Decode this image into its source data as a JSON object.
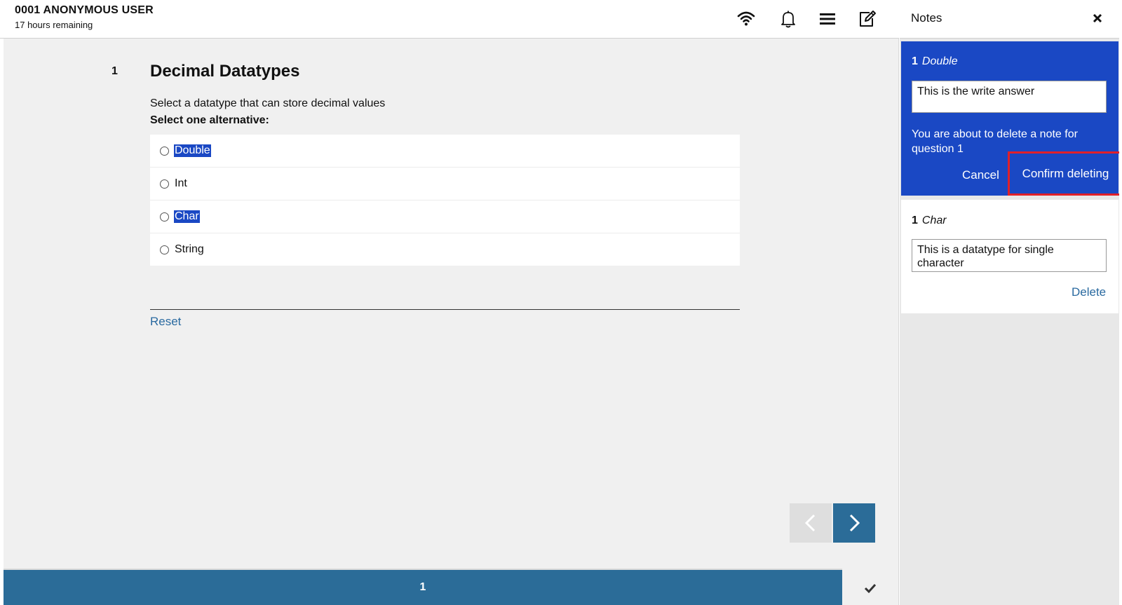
{
  "header": {
    "user_name": "0001 ANONYMOUS USER",
    "time_remaining": "17 hours remaining",
    "icons": [
      "wifi-icon",
      "bell-icon",
      "menu-icon",
      "edit-note-icon"
    ]
  },
  "question": {
    "number": "1",
    "title": "Decimal Datatypes",
    "text": "Select a datatype that can store decimal values",
    "instruction": "Select one alternative:",
    "options": [
      {
        "label": "Double",
        "highlighted": true,
        "selected": false
      },
      {
        "label": "Int",
        "highlighted": false,
        "selected": false
      },
      {
        "label": "Char",
        "highlighted": true,
        "selected": false
      },
      {
        "label": "String",
        "highlighted": false,
        "selected": false
      }
    ],
    "reset_label": "Reset"
  },
  "footer": {
    "page_number": "1"
  },
  "notes": {
    "title": "Notes",
    "active_note": {
      "question": "1",
      "option": "Double",
      "text": "This is the write answer",
      "confirm_message": "You are about to delete a note for question 1",
      "cancel_label": "Cancel",
      "confirm_label": "Confirm deleting"
    },
    "note": {
      "question": "1",
      "option": "Char",
      "text": "This is a datatype for single character",
      "delete_label": "Delete"
    }
  },
  "colors": {
    "primary": "#2b6c98",
    "highlight": "#1a48c4",
    "alert_border": "#e0202a",
    "link": "#2a6aa0"
  }
}
